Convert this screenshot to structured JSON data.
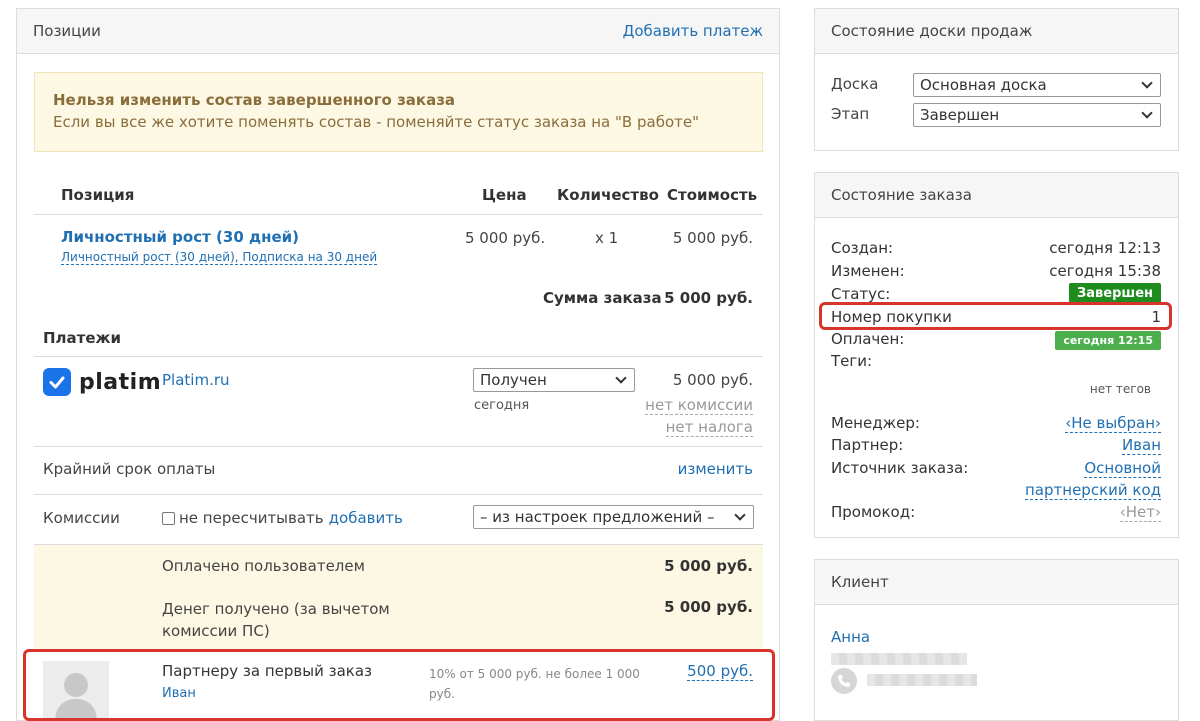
{
  "positions": {
    "title": "Позиции",
    "add_payment": "Добавить платеж",
    "alert": {
      "title": "Нельзя изменить состав завершенного заказа",
      "text": "Если вы все же хотите поменять состав - поменяйте статус заказа на \"В работе\""
    },
    "table": {
      "col_position": "Позиция",
      "col_price": "Цена",
      "col_qty": "Количество",
      "col_cost": "Стоимость",
      "item_title": "Личностный рост (30 дней)",
      "item_subtitle": "Личностный рост (30 дней), Подписка на 30 дней",
      "item_price": "5 000 руб.",
      "item_qty": "x 1",
      "item_cost": "5 000 руб.",
      "sum_label": "Сумма заказа",
      "sum_value": "5 000 руб."
    },
    "payments": {
      "title": "Платежи",
      "logo_text": "platim",
      "provider": "Platim.ru",
      "status_value": "Получен",
      "date": "сегодня",
      "amount": "5 000 руб.",
      "no_commission": "нет комиссии",
      "no_tax": "нет налога"
    },
    "deadline": {
      "label": "Крайний срок оплаты",
      "action": "изменить"
    },
    "commissions": {
      "label": "Комиссии",
      "checkbox_label": "не пересчитывать",
      "add": "добавить",
      "select_value": "– из настроек предложений –"
    },
    "paid_by_user": {
      "label": "Оплачено пользователем",
      "value": "5 000 руб."
    },
    "money_received": {
      "label": "Денег получено (за вычетом комиссии ПС)",
      "value": "5 000 руб."
    },
    "partner": {
      "label": "Партнеру за первый заказ",
      "name": "Иван",
      "note": "10% от 5 000 руб. не более 1 000 руб.",
      "value": "500 руб."
    }
  },
  "board": {
    "title": "Состояние доски продаж",
    "board_label": "Доска",
    "board_value": "Основная доска",
    "stage_label": "Этап",
    "stage_value": "Завершен"
  },
  "order": {
    "title": "Состояние заказа",
    "created_label": "Создан:",
    "created_value": "сегодня 12:13",
    "changed_label": "Изменен:",
    "changed_value": "сегодня 15:38",
    "status_label": "Статус:",
    "status_value": "Завершен",
    "purchase_label": "Номер покупки",
    "purchase_value": "1",
    "paid_label": "Оплачен:",
    "paid_value": "сегодня 12:15",
    "tags_label": "Теги:",
    "tags_value": "нет тегов",
    "manager_label": "Менеджер:",
    "manager_value": "‹Не выбран›",
    "partner_label": "Партнер:",
    "partner_value": "Иван",
    "source_label": "Источник заказа:",
    "source_value_1": "Основной",
    "source_value_2": "партнерский код",
    "promo_label": "Промокод:",
    "promo_value": "‹Нет›"
  },
  "client": {
    "title": "Клиент",
    "name": "Анна"
  },
  "colors": {
    "green_badge": "#1e8c1e",
    "green_badge_light": "#4cae4c",
    "alert_bg": "#fcf8e3",
    "highlight_bg": "#fcf8e3",
    "red_outline": "#d9342b",
    "link": "#1f6fb2"
  }
}
